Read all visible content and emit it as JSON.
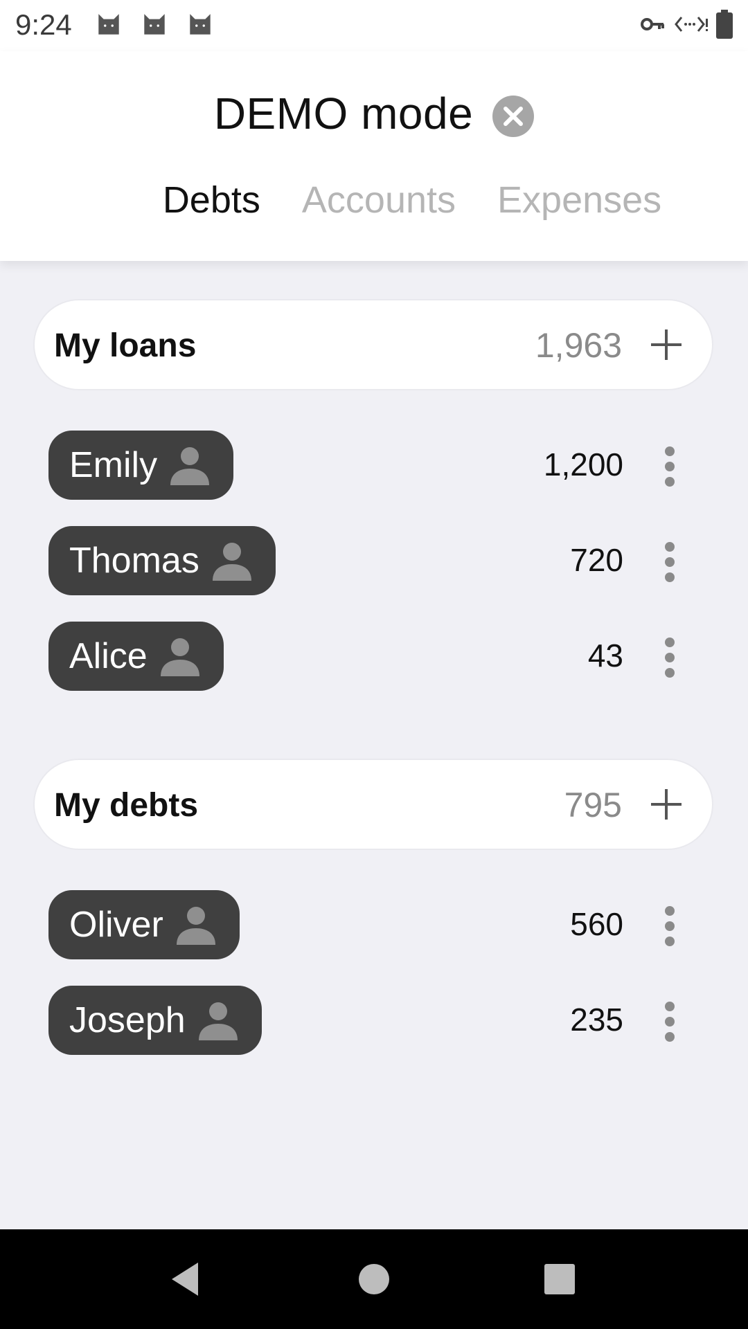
{
  "status_bar": {
    "time": "9:24",
    "notification_icons": [
      "cat-icon",
      "cat-icon",
      "cat-icon"
    ],
    "right_icons": [
      "vpn-key-icon",
      "data-saver-icon",
      "battery-icon"
    ]
  },
  "header": {
    "title": "DEMO mode",
    "close_icon": "close-icon",
    "tabs": [
      {
        "label": "Debts",
        "active": true
      },
      {
        "label": "Accounts",
        "active": false
      },
      {
        "label": "Expenses",
        "active": false
      }
    ]
  },
  "sections": [
    {
      "title": "My loans",
      "total": "1,963",
      "rows": [
        {
          "name": "Emily",
          "amount": "1,200"
        },
        {
          "name": "Thomas",
          "amount": "720"
        },
        {
          "name": "Alice",
          "amount": "43"
        }
      ]
    },
    {
      "title": "My debts",
      "total": "795",
      "rows": [
        {
          "name": "Oliver",
          "amount": "560"
        },
        {
          "name": "Joseph",
          "amount": "235"
        }
      ]
    }
  ],
  "nav_bar": {
    "buttons": [
      "back-icon",
      "home-icon",
      "recents-icon"
    ]
  },
  "colors": {
    "background": "#f0f0f5",
    "chip": "#404040",
    "tab_inactive": "#b5b5b5",
    "close_button": "#a6a6a6"
  }
}
